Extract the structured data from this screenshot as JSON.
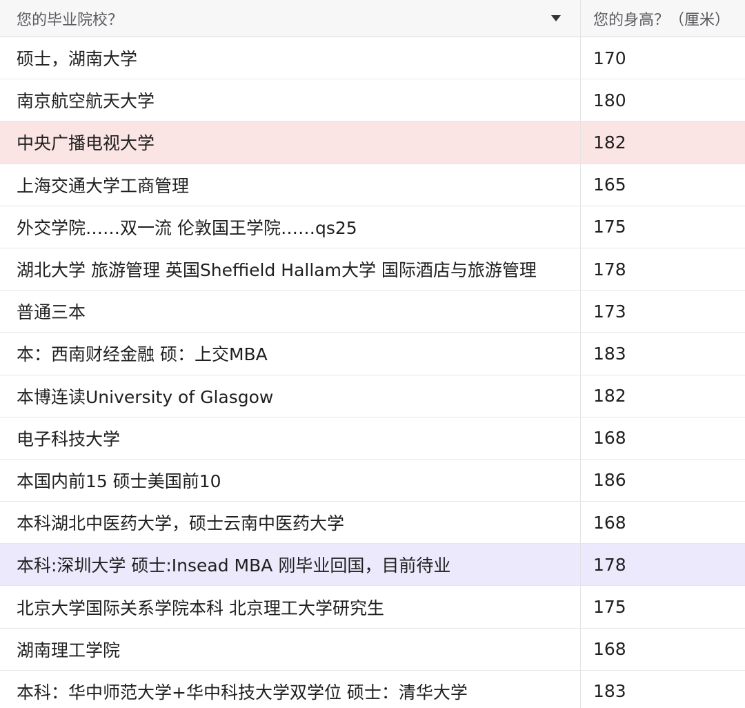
{
  "columns": {
    "school": "您的毕业院校？",
    "height": "您的身高？（厘米）"
  },
  "colors": {
    "highlight_pink": "#fbe4e4",
    "highlight_purple": "#ebe9fb"
  },
  "rows": [
    {
      "school": "硕士，湖南大学",
      "height": "170",
      "highlight": ""
    },
    {
      "school": "南京航空航天大学",
      "height": "180",
      "highlight": ""
    },
    {
      "school": "中央广播电视大学",
      "height": "182",
      "highlight": "pink"
    },
    {
      "school": "上海交通大学工商管理",
      "height": "165",
      "highlight": ""
    },
    {
      "school": "外交学院……双一流 伦敦国王学院……qs25",
      "height": "175",
      "highlight": ""
    },
    {
      "school": "湖北大学 旅游管理 英国Sheffield Hallam大学 国际酒店与旅游管理",
      "height": "178",
      "highlight": ""
    },
    {
      "school": "普通三本",
      "height": "173",
      "highlight": ""
    },
    {
      "school": "本：西南财经金融 硕：上交MBA",
      "height": "183",
      "highlight": ""
    },
    {
      "school": "本博连读University of Glasgow",
      "height": "182",
      "highlight": ""
    },
    {
      "school": "电子科技大学",
      "height": "168",
      "highlight": ""
    },
    {
      "school": "本国内前15 硕士美国前10",
      "height": "186",
      "highlight": ""
    },
    {
      "school": "本科湖北中医药大学，硕士云南中医药大学",
      "height": "168",
      "highlight": ""
    },
    {
      "school": "本科:深圳大学 硕士:Insead MBA 刚毕业回国，目前待业",
      "height": "178",
      "highlight": "purple"
    },
    {
      "school": "北京大学国际关系学院本科 北京理工大学研究生",
      "height": "175",
      "highlight": ""
    },
    {
      "school": "湖南理工学院",
      "height": "168",
      "highlight": ""
    },
    {
      "school": "本科：华中师范大学+华中科技大学双学位 硕士：清华大学",
      "height": "183",
      "highlight": ""
    }
  ]
}
